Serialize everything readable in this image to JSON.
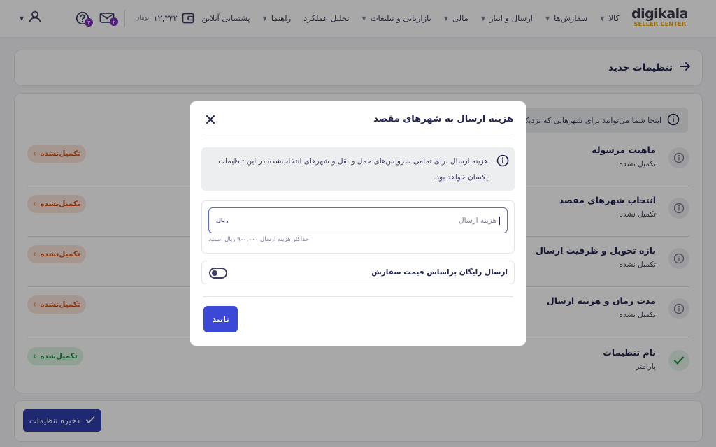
{
  "header": {
    "logo_word": "digikala",
    "logo_sub": "SELLER CENTER",
    "nav": [
      {
        "label": "کالا",
        "has_caret": true
      },
      {
        "label": "سفارش‌ها",
        "has_caret": true
      },
      {
        "label": "ارسال و انبار",
        "has_caret": true
      },
      {
        "label": "مالی",
        "has_caret": true
      },
      {
        "label": "بازاریابی و تبلیغات",
        "has_caret": true
      },
      {
        "label": "تحلیل عملکرد",
        "has_caret": false
      },
      {
        "label": "راهنما",
        "has_caret": true
      },
      {
        "label": "پشتیبانی آنلاین",
        "has_caret": false
      }
    ],
    "balance": "۱۲,۳۴۲",
    "balance_unit": "تومان",
    "messages_badge": "۲",
    "help_badge": "۲"
  },
  "page": {
    "title": "تنظیمات جدید",
    "info_text": "اینجا شما می‌توانید برای شهرهایی که نزدیک",
    "steps": [
      {
        "label": "ماهیت مرسوله",
        "sub": "تکمیل نشده",
        "status": "تکمیل‌نشده",
        "done": false
      },
      {
        "label": "انتخاب شهرهای مقصد",
        "sub": "تکمیل نشده",
        "status": "تکمیل‌نشده",
        "done": false
      },
      {
        "label": "بازه تحویل و ظرفیت ارسال",
        "sub": "تکمیل نشده",
        "status": "تکمیل‌نشده",
        "done": false
      },
      {
        "label": "مدت زمان و هزینه ارسال",
        "sub": "تکمیل نشده",
        "status": "تکمیل‌نشده",
        "done": false
      },
      {
        "label": "نام تنظیمات",
        "sub": "پارامتر",
        "status": "تکمیل‌شده",
        "done": true
      }
    ],
    "save_label": "ذخیره تنظیمات"
  },
  "modal": {
    "title": "هزینه ارسال به شهرهای مقصد",
    "notice": "هزینه ارسال برای تمامی سرویس‌های حمل و نقل و شهرهای انتخاب‌شده در این تنظیمات یکسان خواهد بود.",
    "price_placeholder": "هزینه ارسال",
    "price_value": "",
    "currency": "ریال",
    "price_hint": "حداکثر هزینه ارسال ۹۰۰,۰۰۰ ریال است.",
    "free_shipping_label": "ارسال رایگان براساس قیمت سفارش",
    "free_shipping_enabled": false,
    "confirm_label": "تایید"
  },
  "colors": {
    "brand_blue": "#3b49d6",
    "save_blue": "#2e3fae",
    "incomplete": "#d4571c",
    "complete": "#1f8f43",
    "badge_purple": "#7b2cbf"
  }
}
